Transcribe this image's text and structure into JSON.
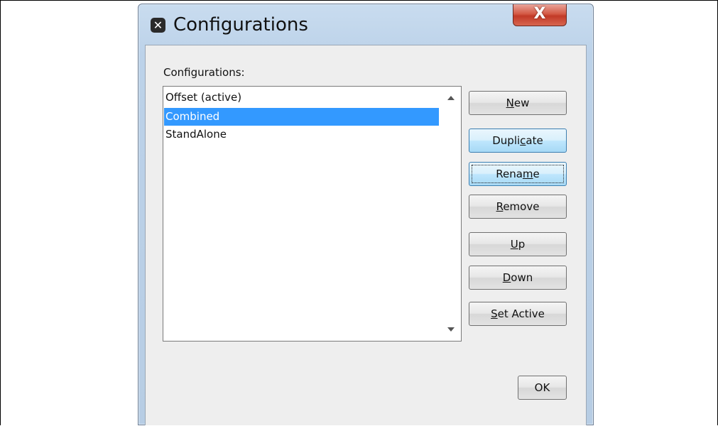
{
  "window": {
    "title": "Configurations",
    "close_glyph": "X"
  },
  "list": {
    "label": "Configurations:",
    "items": [
      {
        "label": "Offset (active)",
        "selected": false
      },
      {
        "label": "Combined",
        "selected": true
      },
      {
        "label": "StandAlone",
        "selected": false
      }
    ]
  },
  "buttons": {
    "new": {
      "pre": "",
      "mn": "N",
      "post": "ew"
    },
    "duplicate": {
      "pre": "Dupli",
      "mn": "c",
      "post": "ate"
    },
    "rename": {
      "pre": "Rena",
      "mn": "m",
      "post": "e"
    },
    "remove": {
      "pre": "",
      "mn": "R",
      "post": "emove"
    },
    "up": {
      "pre": "",
      "mn": "U",
      "post": "p"
    },
    "down": {
      "pre": "",
      "mn": "D",
      "post": "own"
    },
    "set_active": {
      "pre": "",
      "mn": "S",
      "post": "et Active"
    },
    "ok": "OK"
  },
  "colors": {
    "selection": "#3399ff",
    "close_button": "#c8452f",
    "title_bar": "#bcd2e9"
  },
  "icons": {
    "title": "app-x-icon",
    "close": "close-icon",
    "scroll_up": "scroll-up-arrow-icon",
    "scroll_down": "scroll-down-arrow-icon"
  }
}
